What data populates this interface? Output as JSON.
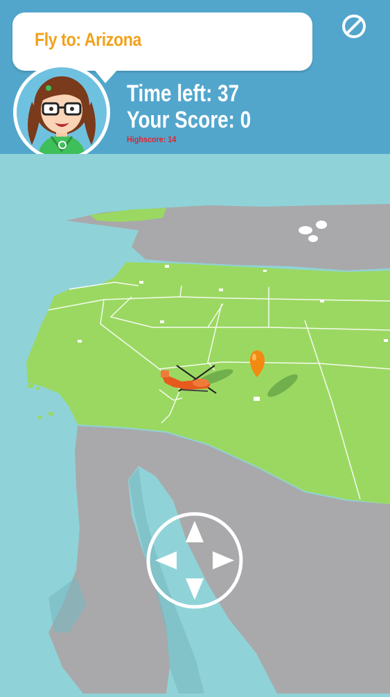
{
  "prompt": {
    "label": "Fly to:",
    "target": "Arizona",
    "text": "Fly to: Arizona"
  },
  "stats": {
    "time_left_label": "Time left:",
    "time_left_value": 37,
    "time_left_text": "Time left: 37",
    "score_label": "Your Score:",
    "score_value": 0,
    "score_text": "Your Score: 0",
    "highscore_label": "Highscore:",
    "highscore_value": 14,
    "highscore_text": "Highscore: 14"
  },
  "icons": {
    "stop": "stop-icon",
    "dpad": "directional-pad-icon",
    "helicopter": "helicopter-icon",
    "target_marker": "location-pin-icon",
    "avatar": "girl-avatar-icon"
  },
  "colors": {
    "header": "#52a6cc",
    "prompt_text": "#f2a21c",
    "highscore_text": "#e0242c",
    "ocean": "#8fd3d8",
    "land_us": "#9bd862",
    "land_other": "#a9a9ab",
    "marker": "#f28a12"
  }
}
